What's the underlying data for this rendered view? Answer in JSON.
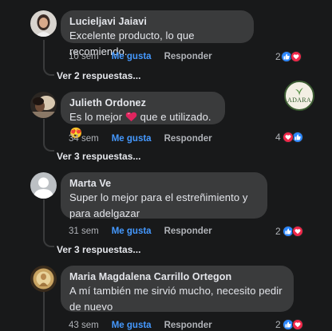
{
  "comments": [
    {
      "author": "Lucieljavi Jaiavi",
      "text": "Excelente producto, lo que recomiendo.",
      "time": "10 sem",
      "like_label": "Me gusta",
      "reply_label": "Responder",
      "reaction_count": "2",
      "replies_label": "Ver 2 respuestas..."
    },
    {
      "author": "Julieth Ordonez",
      "text_before": "Es lo mejor",
      "text_after": "que e utilizado.",
      "trailing_emoji": "😍",
      "time": "34 sem",
      "like_label": "Me gusta",
      "reply_label": "Responder",
      "reaction_count": "4",
      "replies_label": "Ver 3 respuestas..."
    },
    {
      "author": "Marta Ve",
      "text": "Super lo mejor para el estreñimiento y para adelgazar",
      "time": "31 sem",
      "like_label": "Me gusta",
      "reply_label": "Responder",
      "reaction_count": "2",
      "replies_label": "Ver 3 respuestas..."
    },
    {
      "author": "Maria Magdalena Carrillo Ortegon",
      "text": "A mí también me sirvió mucho, necesito pedir de nuevo",
      "time": "43 sem",
      "like_label": "Me gusta",
      "reply_label": "Responder",
      "reaction_count": "2"
    }
  ],
  "page_badge": {
    "name": "ADARA"
  },
  "colors": {
    "background": "#18191a",
    "bubble": "#3a3b3c",
    "liked": "#4599ff",
    "love": "#f0284a",
    "like": "#2d88ff"
  },
  "icons": [
    "like-reaction-icon",
    "love-reaction-icon",
    "heart-emoji-icon",
    "heart-eyes-emoji-icon",
    "default-avatar-icon"
  ]
}
